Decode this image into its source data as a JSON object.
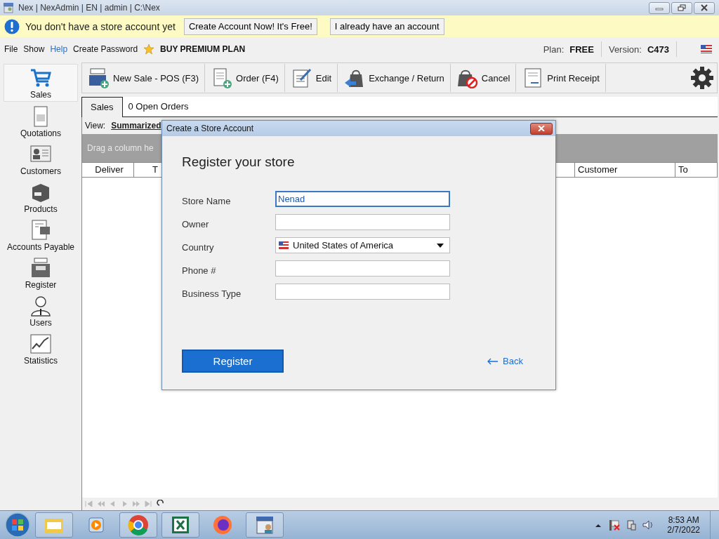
{
  "window": {
    "title": "Nex | NexAdmin | EN | admin | C:\\Nex"
  },
  "banner": {
    "message": "You don't have a store account yet",
    "buttons": [
      "Create Account Now! It's Free!",
      "I already have an account"
    ]
  },
  "menu": [
    {
      "label": "File",
      "highlighted": false
    },
    {
      "label": "Show",
      "highlighted": false
    },
    {
      "label": "Help",
      "highlighted": true
    },
    {
      "label": "Create Password",
      "highlighted": false
    }
  ],
  "premium": "BUY PREMIUM PLAN",
  "plan": {
    "label": "Plan:",
    "value": "FREE"
  },
  "version": {
    "label": "Version:",
    "value": "C473"
  },
  "sidebar": {
    "items": [
      {
        "label": "Sales",
        "selected": true
      },
      {
        "label": "Quotations",
        "selected": false
      },
      {
        "label": "Customers",
        "selected": false
      },
      {
        "label": "Products",
        "selected": false
      },
      {
        "label": "Accounts Payable",
        "selected": false
      },
      {
        "label": "Register",
        "selected": false
      },
      {
        "label": "Users",
        "selected": false
      },
      {
        "label": "Statistics",
        "selected": false
      }
    ]
  },
  "toolbar": {
    "buttons": [
      "New Sale - POS (F3)",
      "Order (F4)",
      "Edit",
      "Exchange / Return",
      "Cancel",
      "Print Receipt"
    ]
  },
  "tabs": [
    {
      "label": "Sales",
      "selected": true
    },
    {
      "label": "0 Open Orders",
      "selected": false
    }
  ],
  "view": {
    "label": "View:",
    "value": "Summarized"
  },
  "group_hint": "Drag a column he",
  "table": {
    "columns": [
      "Deliver",
      "T",
      "Customer",
      "To"
    ]
  },
  "dialog": {
    "title": "Create a Store Account",
    "heading": "Register your store",
    "fields": [
      {
        "label": "Store Name",
        "kind": "text",
        "value": "Nenad",
        "focused": true
      },
      {
        "label": "Owner",
        "kind": "text",
        "focused": false
      },
      {
        "label": "Country",
        "kind": "select",
        "value": "United States of America",
        "focused": false
      },
      {
        "label": "Phone #",
        "kind": "text",
        "focused": false
      },
      {
        "label": "Business Type",
        "kind": "text",
        "focused": false
      }
    ],
    "register": "Register",
    "back": "Back"
  },
  "taskbar": {
    "time": "8:53 AM",
    "date": "2/7/2022"
  }
}
